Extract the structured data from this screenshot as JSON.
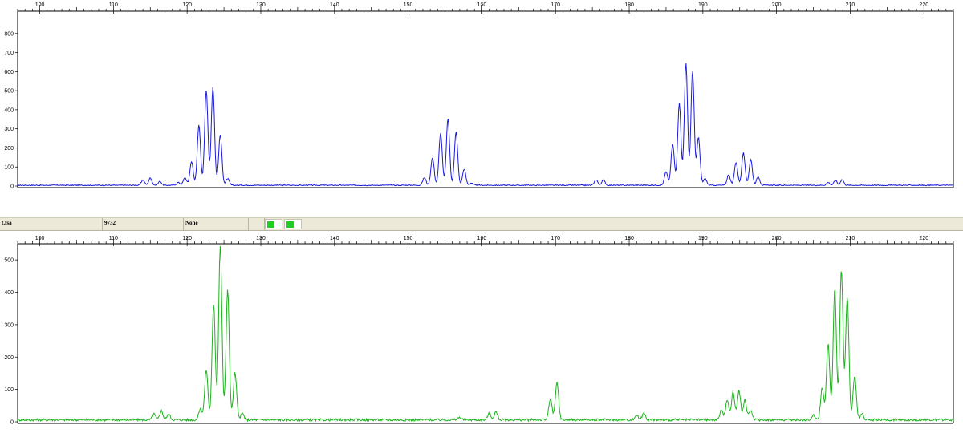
{
  "status_bar": {
    "file_label": "f.fsa",
    "sample_id": "9732",
    "comment": "None",
    "dye_swatches": [
      {
        "icon": "dye-channel-green-icon",
        "color": "#22cc22"
      },
      {
        "icon": "dye-channel-green-icon",
        "color": "#22cc22"
      }
    ]
  },
  "chart_data": [
    {
      "type": "line",
      "title": "",
      "xlabel": "",
      "ylabel": "",
      "xlim": [
        97,
        224
      ],
      "ylim": [
        0,
        900
      ],
      "x_ticks": [
        100,
        110,
        120,
        130,
        140,
        150,
        160,
        170,
        180,
        190,
        200,
        210,
        220
      ],
      "y_ticks": [
        0,
        100,
        200,
        300,
        400,
        500,
        600,
        700,
        800
      ],
      "grid": false,
      "series": [
        {
          "color": "#1a1adc",
          "baseline": 4,
          "peaks": [
            {
              "x": 114.0,
              "y": 28
            },
            {
              "x": 115.0,
              "y": 38
            },
            {
              "x": 116.3,
              "y": 20
            },
            {
              "x": 118.8,
              "y": 15
            },
            {
              "x": 119.7,
              "y": 40
            },
            {
              "x": 120.6,
              "y": 125
            },
            {
              "x": 121.6,
              "y": 315
            },
            {
              "x": 122.6,
              "y": 500
            },
            {
              "x": 123.5,
              "y": 515
            },
            {
              "x": 124.5,
              "y": 265
            },
            {
              "x": 125.5,
              "y": 35
            },
            {
              "x": 152.2,
              "y": 40
            },
            {
              "x": 153.3,
              "y": 145
            },
            {
              "x": 154.4,
              "y": 275
            },
            {
              "x": 155.4,
              "y": 350
            },
            {
              "x": 156.5,
              "y": 280
            },
            {
              "x": 157.6,
              "y": 85
            },
            {
              "x": 158.6,
              "y": 12
            },
            {
              "x": 175.5,
              "y": 30
            },
            {
              "x": 176.5,
              "y": 28
            },
            {
              "x": 185.0,
              "y": 70
            },
            {
              "x": 185.9,
              "y": 215
            },
            {
              "x": 186.8,
              "y": 430
            },
            {
              "x": 187.7,
              "y": 640
            },
            {
              "x": 188.6,
              "y": 600
            },
            {
              "x": 189.4,
              "y": 250
            },
            {
              "x": 190.3,
              "y": 35
            },
            {
              "x": 193.5,
              "y": 55
            },
            {
              "x": 194.5,
              "y": 120
            },
            {
              "x": 195.5,
              "y": 170
            },
            {
              "x": 196.5,
              "y": 135
            },
            {
              "x": 197.5,
              "y": 45
            },
            {
              "x": 207.0,
              "y": 15
            },
            {
              "x": 208.0,
              "y": 25
            },
            {
              "x": 208.9,
              "y": 30
            }
          ]
        }
      ]
    },
    {
      "type": "line",
      "title": "",
      "xlabel": "",
      "ylabel": "",
      "xlim": [
        97,
        224
      ],
      "ylim": [
        0,
        540
      ],
      "x_ticks": [
        100,
        110,
        120,
        130,
        140,
        150,
        160,
        170,
        180,
        190,
        200,
        210,
        220
      ],
      "y_ticks": [
        0,
        100,
        200,
        300,
        400,
        500
      ],
      "grid": false,
      "series": [
        {
          "color": "#1db31d",
          "baseline": 6,
          "peaks": [
            {
              "x": 115.5,
              "y": 18
            },
            {
              "x": 116.5,
              "y": 28
            },
            {
              "x": 117.5,
              "y": 18
            },
            {
              "x": 121.8,
              "y": 35
            },
            {
              "x": 122.6,
              "y": 155
            },
            {
              "x": 123.6,
              "y": 355
            },
            {
              "x": 124.5,
              "y": 540
            },
            {
              "x": 125.5,
              "y": 400
            },
            {
              "x": 126.5,
              "y": 145
            },
            {
              "x": 127.5,
              "y": 20
            },
            {
              "x": 157.0,
              "y": 8
            },
            {
              "x": 161.0,
              "y": 20
            },
            {
              "x": 161.9,
              "y": 25
            },
            {
              "x": 169.3,
              "y": 65
            },
            {
              "x": 170.2,
              "y": 115
            },
            {
              "x": 181.0,
              "y": 15
            },
            {
              "x": 182.0,
              "y": 22
            },
            {
              "x": 192.5,
              "y": 30
            },
            {
              "x": 193.3,
              "y": 60
            },
            {
              "x": 194.1,
              "y": 85
            },
            {
              "x": 194.9,
              "y": 90
            },
            {
              "x": 195.7,
              "y": 62
            },
            {
              "x": 196.5,
              "y": 30
            },
            {
              "x": 205.0,
              "y": 15
            },
            {
              "x": 206.2,
              "y": 100
            },
            {
              "x": 207.0,
              "y": 235
            },
            {
              "x": 207.9,
              "y": 405
            },
            {
              "x": 208.8,
              "y": 465
            },
            {
              "x": 209.6,
              "y": 380
            },
            {
              "x": 210.6,
              "y": 135
            },
            {
              "x": 211.6,
              "y": 20
            }
          ]
        }
      ]
    }
  ]
}
